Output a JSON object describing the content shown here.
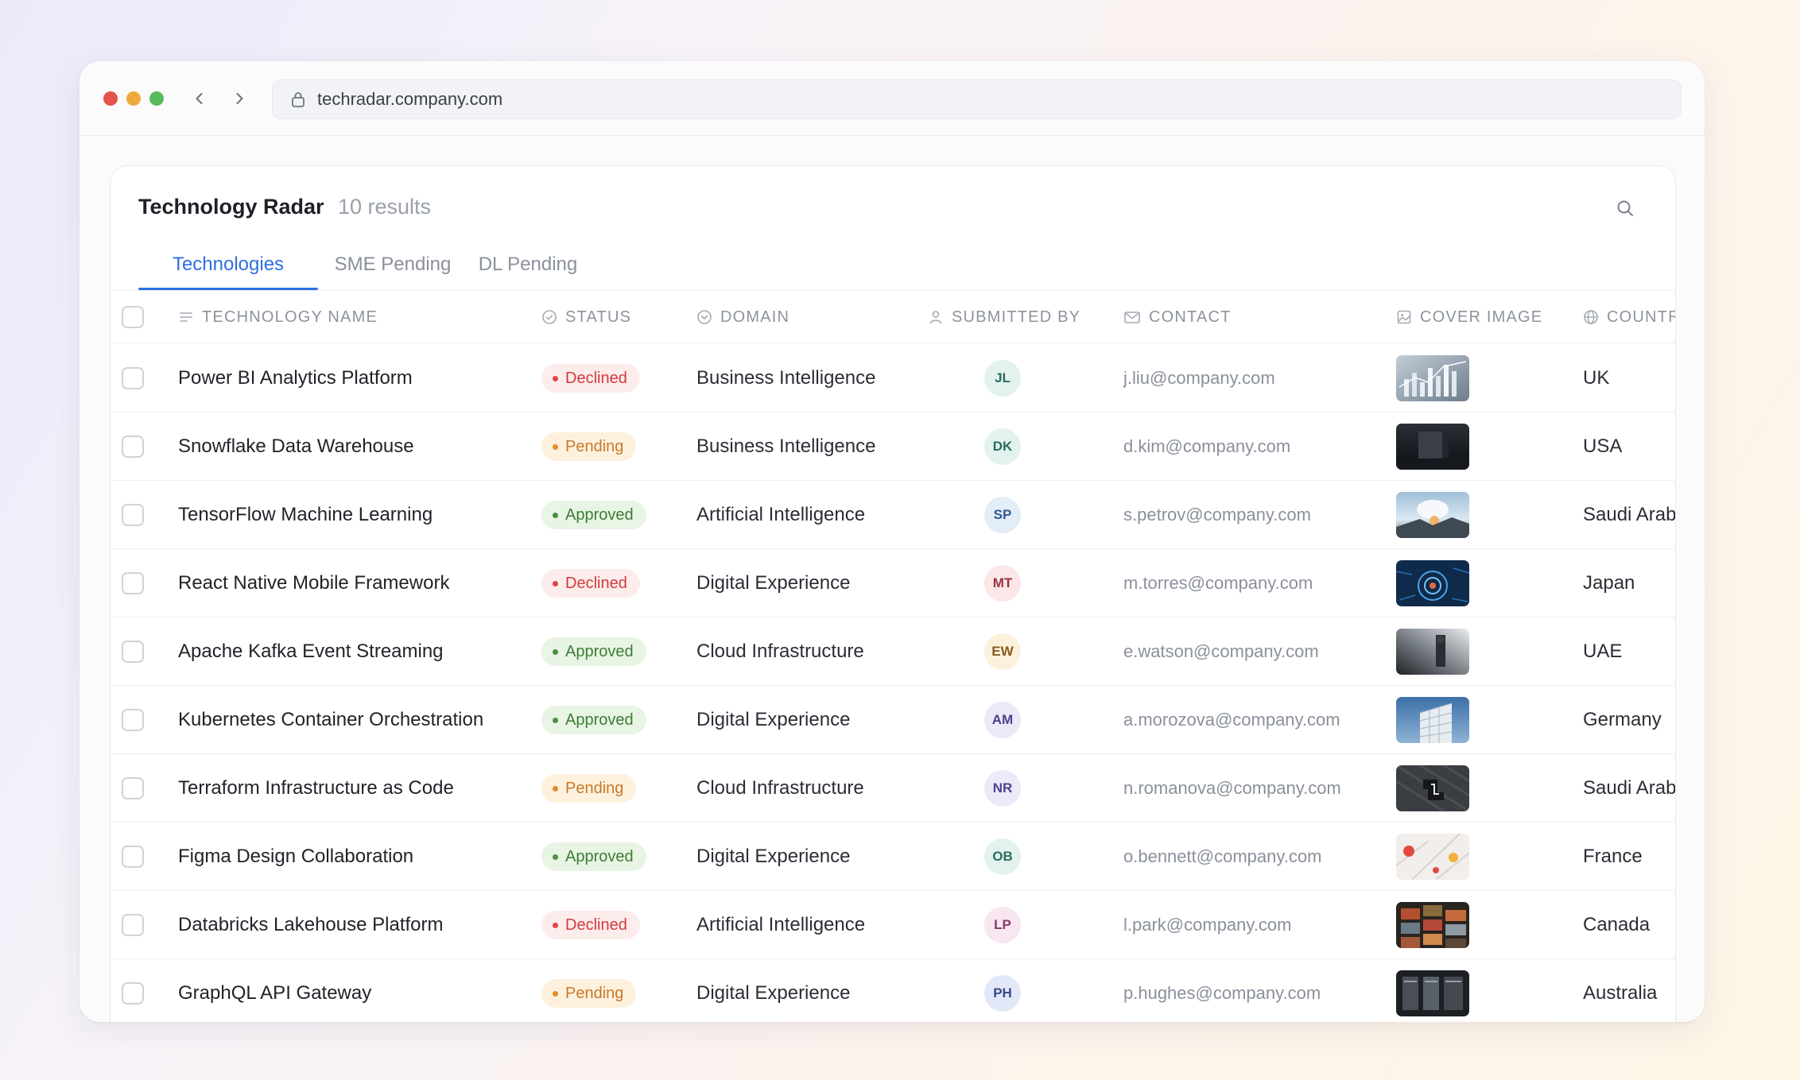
{
  "browser": {
    "url": "techradar.company.com"
  },
  "header": {
    "title": "Technology Radar",
    "count": "10 results"
  },
  "tabs": [
    {
      "label": "Technologies",
      "active": true
    },
    {
      "label": "SME Pending",
      "active": false
    },
    {
      "label": "DL Pending",
      "active": false
    }
  ],
  "columns": {
    "name": "TECHNOLOGY NAME",
    "status": "STATUS",
    "domain": "DOMAIN",
    "submitted_by": "SUBMITTED BY",
    "contact": "CONTACT",
    "cover_image": "COVER IMAGE",
    "country": "COUNTR"
  },
  "colors": {
    "accent": "#2f6fe0",
    "declined": "#d23b3b",
    "pending": "#c8792a",
    "approved": "#3c7d34"
  },
  "rows": [
    {
      "name": "Power BI Analytics Platform",
      "status": "Declined",
      "domain": "Business Intelligence",
      "initials": "JL",
      "contact": "j.liu@company.com",
      "country": "UK"
    },
    {
      "name": "Snowflake Data Warehouse",
      "status": "Pending",
      "domain": "Business Intelligence",
      "initials": "DK",
      "contact": "d.kim@company.com",
      "country": "USA"
    },
    {
      "name": "TensorFlow Machine Learning",
      "status": "Approved",
      "domain": "Artificial Intelligence",
      "initials": "SP",
      "contact": "s.petrov@company.com",
      "country": "Saudi Arab"
    },
    {
      "name": "React Native Mobile Framework",
      "status": "Declined",
      "domain": "Digital Experience",
      "initials": "MT",
      "contact": "m.torres@company.com",
      "country": "Japan"
    },
    {
      "name": "Apache Kafka Event Streaming",
      "status": "Approved",
      "domain": "Cloud Infrastructure",
      "initials": "EW",
      "contact": "e.watson@company.com",
      "country": "UAE"
    },
    {
      "name": "Kubernetes Container Orchestration",
      "status": "Approved",
      "domain": "Digital Experience",
      "initials": "AM",
      "contact": "a.morozova@company.com",
      "country": "Germany"
    },
    {
      "name": "Terraform Infrastructure as Code",
      "status": "Pending",
      "domain": "Cloud Infrastructure",
      "initials": "NR",
      "contact": "n.romanova@company.com",
      "country": "Saudi Arab"
    },
    {
      "name": "Figma Design Collaboration",
      "status": "Approved",
      "domain": "Digital Experience",
      "initials": "OB",
      "contact": "o.bennett@company.com",
      "country": "France"
    },
    {
      "name": "Databricks Lakehouse Platform",
      "status": "Declined",
      "domain": "Artificial Intelligence",
      "initials": "LP",
      "contact": "l.park@company.com",
      "country": "Canada"
    },
    {
      "name": "GraphQL API Gateway",
      "status": "Pending",
      "domain": "Digital Experience",
      "initials": "PH",
      "contact": "p.hughes@company.com",
      "country": "Australia"
    }
  ]
}
